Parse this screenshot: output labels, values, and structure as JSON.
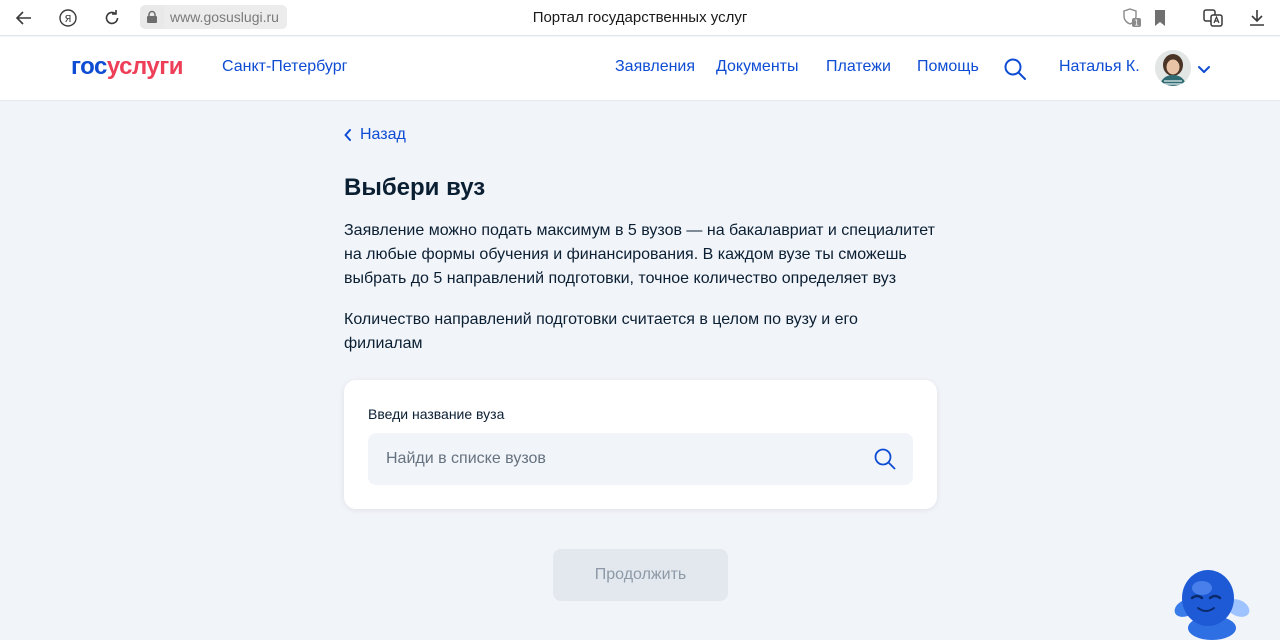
{
  "browser": {
    "url": "www.gosuslugi.ru",
    "title": "Портал государственных услуг",
    "shield_badge": "1"
  },
  "header": {
    "logo_part1": "гос",
    "logo_part2": "услуги",
    "region": "Санкт-Петербург",
    "nav": [
      "Заявления",
      "Документы",
      "Платежи",
      "Помощь"
    ],
    "user_name": "Наталья К."
  },
  "main": {
    "back_label": "Назад",
    "title": "Выбери вуз",
    "paragraphs": [
      [
        "Заявление можно подать максимум в 5 вузов — на бакалавриат и специалитет",
        "на любые формы обучения и финансирования. В каждом вузе ты сможешь",
        "выбрать до 5 направлений подготовки, точное количество определяет вуз"
      ],
      [
        "Количество направлений подготовки считается в целом по вузу и его",
        "филиалам"
      ]
    ],
    "search_card": {
      "label": "Введи название вуза",
      "placeholder": "Найди в списке вузов",
      "value": ""
    },
    "continue_label": "Продолжить"
  },
  "colors": {
    "accent": "#0d4cd3",
    "logo_red": "#ee3f58",
    "background": "#f1f4f9",
    "disabled_button": "#e3e8ef"
  }
}
